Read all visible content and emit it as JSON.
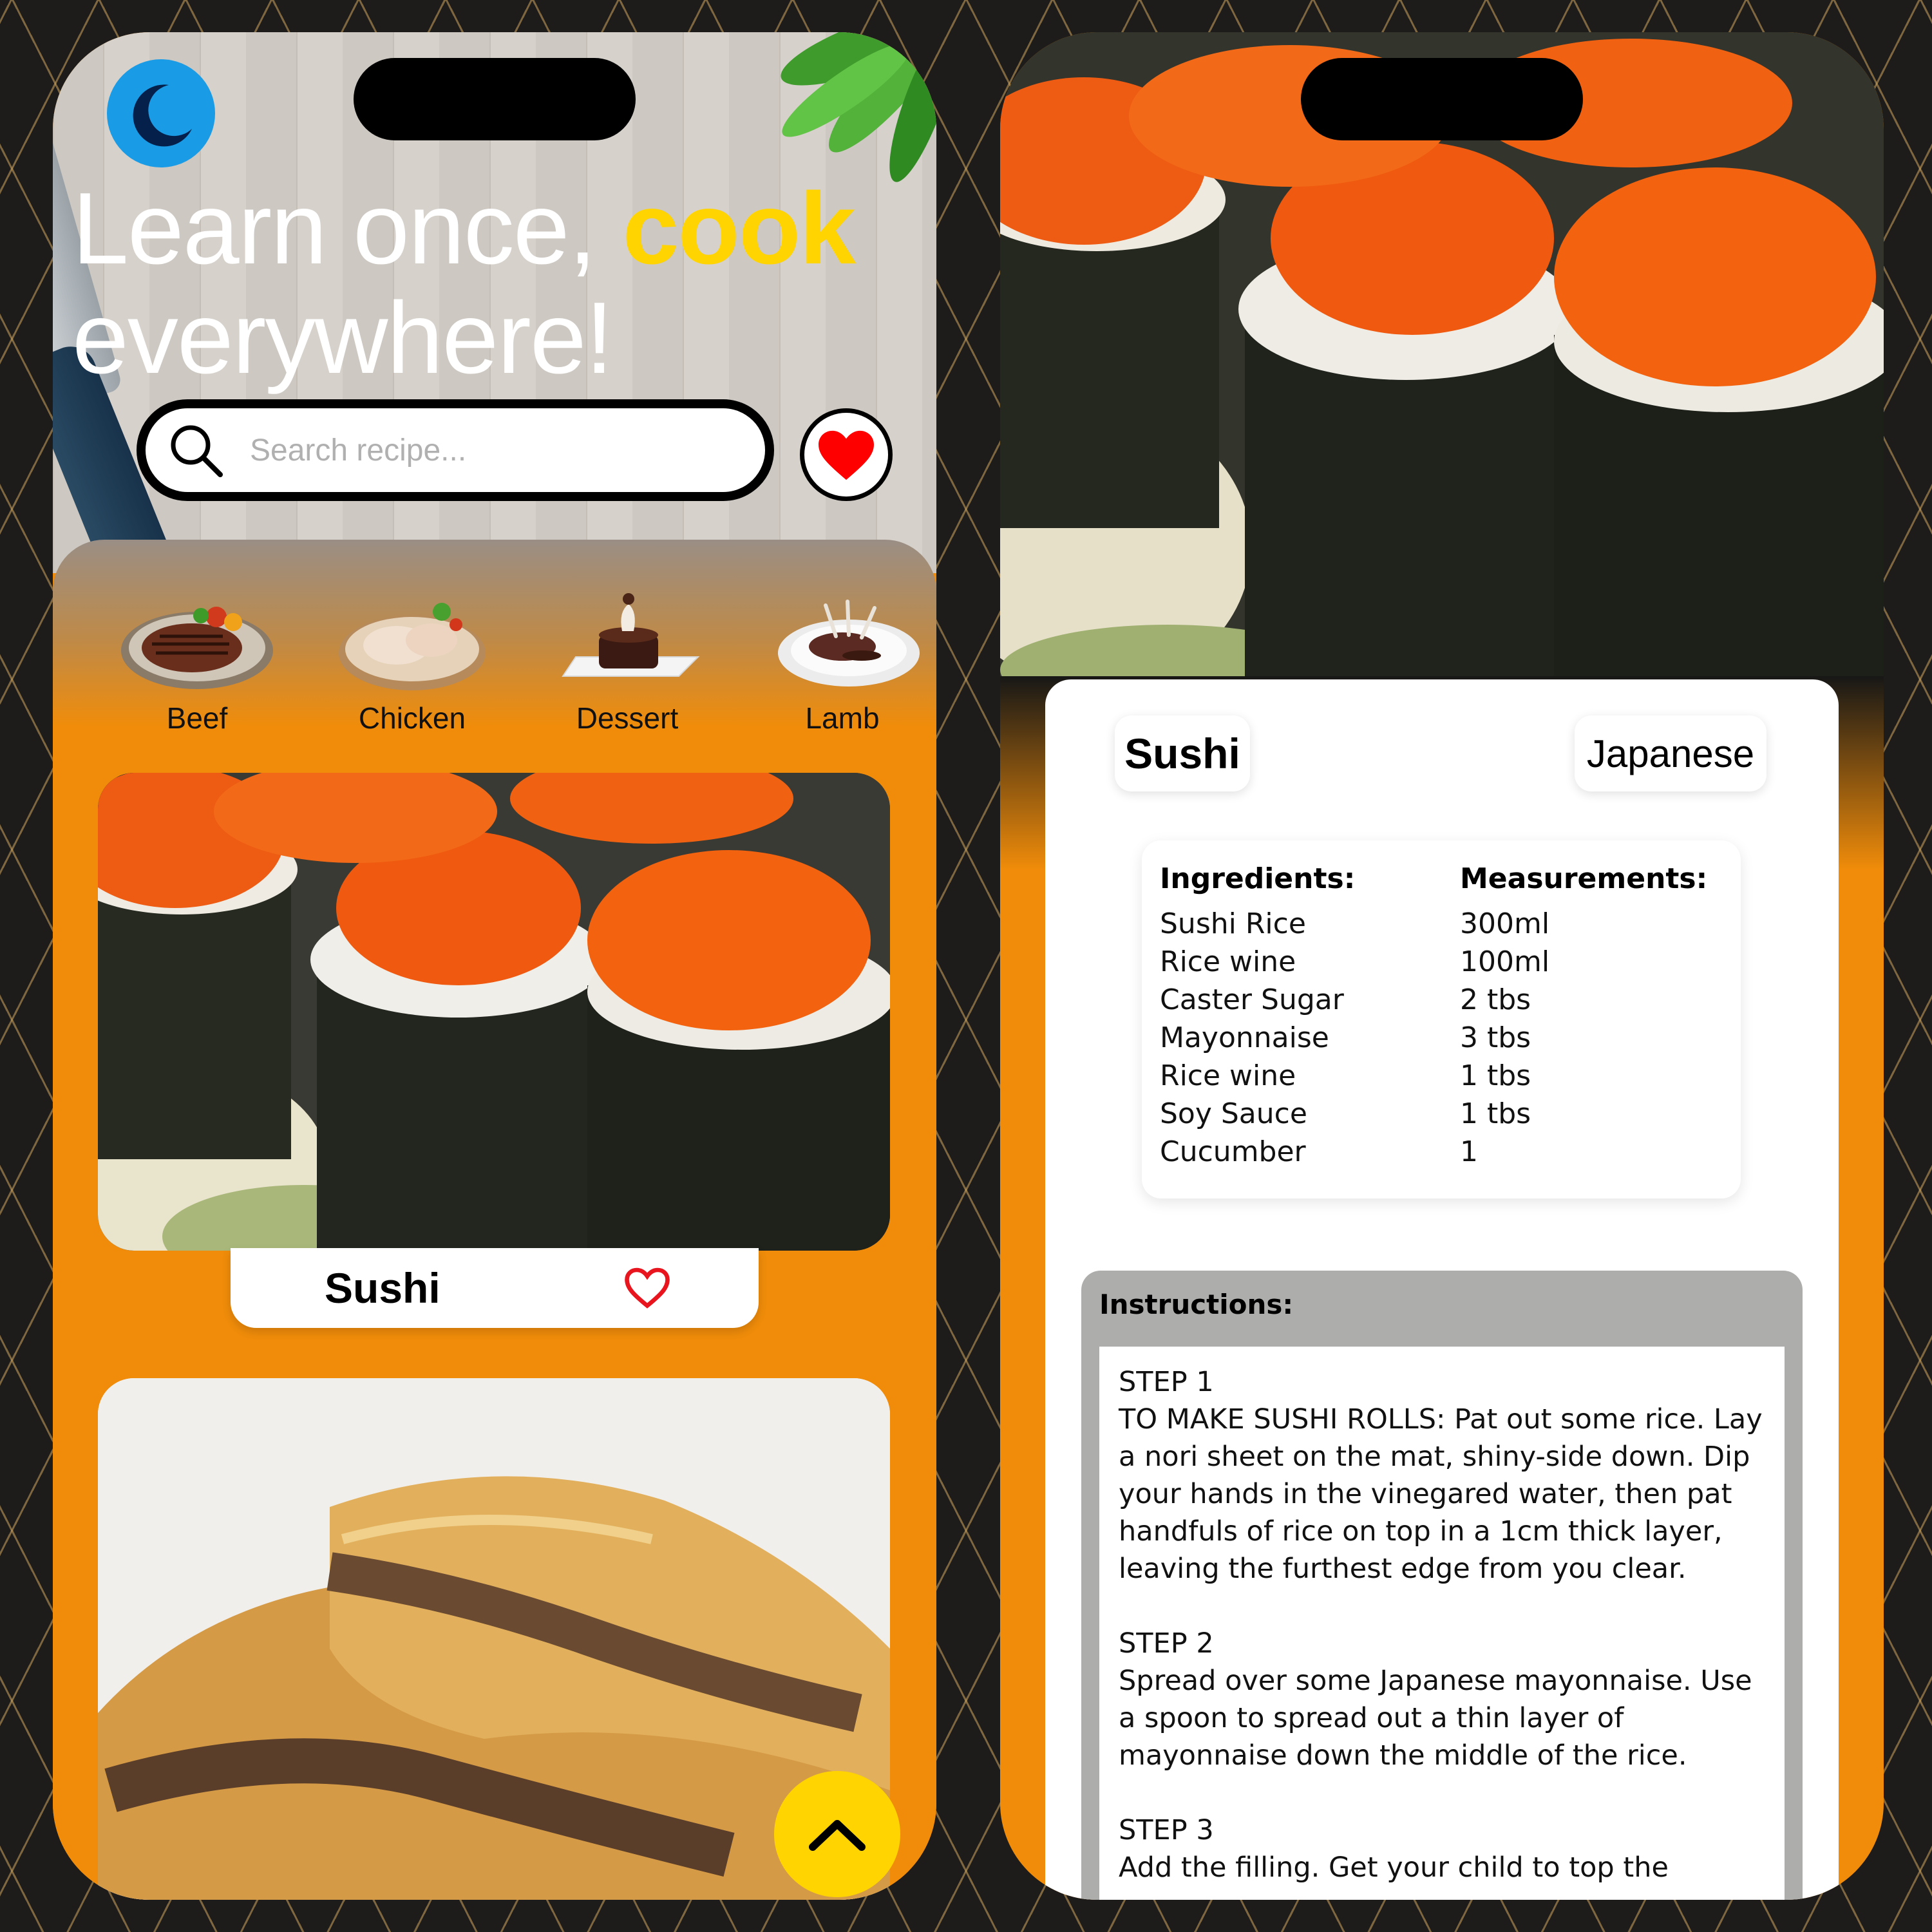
{
  "home": {
    "headline_part1": "Learn once, ",
    "headline_accent": "cook",
    "headline_part2": "everywhere!",
    "search_placeholder": "Search recipe...",
    "categories": [
      {
        "label": "Beef"
      },
      {
        "label": "Chicken"
      },
      {
        "label": "Dessert"
      },
      {
        "label": "Lamb"
      }
    ],
    "recipes": [
      {
        "title": "Sushi"
      }
    ]
  },
  "detail": {
    "title": "Sushi",
    "cuisine": "Japanese",
    "ingredients_header": "Ingredients:",
    "measurements_header": "Measurements:",
    "ingredients": [
      {
        "name": "Sushi Rice",
        "measure": "300ml"
      },
      {
        "name": "Rice wine",
        "measure": "100ml"
      },
      {
        "name": "Caster Sugar",
        "measure": "2 tbs"
      },
      {
        "name": "Mayonnaise",
        "measure": "3 tbs"
      },
      {
        "name": "Rice wine",
        "measure": "1 tbs"
      },
      {
        "name": "Soy Sauce",
        "measure": "1 tbs"
      },
      {
        "name": "Cucumber",
        "measure": "1"
      }
    ],
    "instructions_header": "Instructions:",
    "steps": [
      {
        "label": "STEP 1",
        "text": "TO MAKE SUSHI ROLLS: Pat out some rice. Lay a nori sheet on the mat, shiny-side down. Dip your hands in the vinegared water, then pat handfuls of rice on top in a 1cm thick layer, leaving the furthest edge from you clear."
      },
      {
        "label": "STEP 2",
        "text": "Spread over some Japanese mayonnaise. Use a spoon to spread out a thin layer of mayonnaise down the middle of the rice."
      },
      {
        "label": "STEP 3",
        "text": "Add the filling. Get your child to top the"
      }
    ]
  },
  "colors": {
    "brand_orange": "#f08c0a",
    "accent_yellow": "#ffd400",
    "theme_button_blue": "#1a9be6",
    "favorite_red": "#ff0000"
  },
  "icons": [
    "moon-icon",
    "search-icon",
    "heart-filled-icon",
    "heart-outline-icon",
    "chevron-up-icon"
  ]
}
